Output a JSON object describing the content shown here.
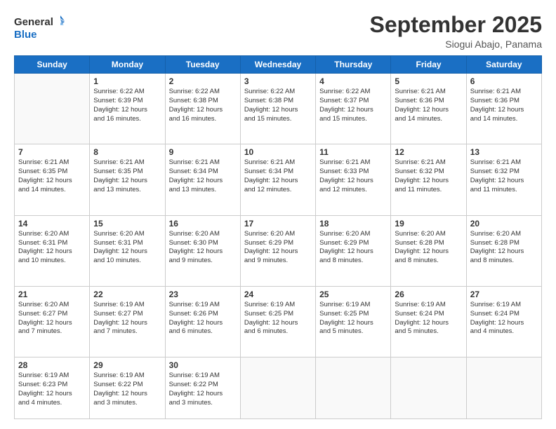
{
  "header": {
    "logo": {
      "line1": "General",
      "line2": "Blue"
    },
    "title": "September 2025",
    "subtitle": "Siogui Abajo, Panama"
  },
  "days_of_week": [
    "Sunday",
    "Monday",
    "Tuesday",
    "Wednesday",
    "Thursday",
    "Friday",
    "Saturday"
  ],
  "weeks": [
    [
      {
        "day": "",
        "info": ""
      },
      {
        "day": "1",
        "info": "Sunrise: 6:22 AM\nSunset: 6:39 PM\nDaylight: 12 hours\nand 16 minutes."
      },
      {
        "day": "2",
        "info": "Sunrise: 6:22 AM\nSunset: 6:38 PM\nDaylight: 12 hours\nand 16 minutes."
      },
      {
        "day": "3",
        "info": "Sunrise: 6:22 AM\nSunset: 6:38 PM\nDaylight: 12 hours\nand 15 minutes."
      },
      {
        "day": "4",
        "info": "Sunrise: 6:22 AM\nSunset: 6:37 PM\nDaylight: 12 hours\nand 15 minutes."
      },
      {
        "day": "5",
        "info": "Sunrise: 6:21 AM\nSunset: 6:36 PM\nDaylight: 12 hours\nand 14 minutes."
      },
      {
        "day": "6",
        "info": "Sunrise: 6:21 AM\nSunset: 6:36 PM\nDaylight: 12 hours\nand 14 minutes."
      }
    ],
    [
      {
        "day": "7",
        "info": "Sunrise: 6:21 AM\nSunset: 6:35 PM\nDaylight: 12 hours\nand 14 minutes."
      },
      {
        "day": "8",
        "info": "Sunrise: 6:21 AM\nSunset: 6:35 PM\nDaylight: 12 hours\nand 13 minutes."
      },
      {
        "day": "9",
        "info": "Sunrise: 6:21 AM\nSunset: 6:34 PM\nDaylight: 12 hours\nand 13 minutes."
      },
      {
        "day": "10",
        "info": "Sunrise: 6:21 AM\nSunset: 6:34 PM\nDaylight: 12 hours\nand 12 minutes."
      },
      {
        "day": "11",
        "info": "Sunrise: 6:21 AM\nSunset: 6:33 PM\nDaylight: 12 hours\nand 12 minutes."
      },
      {
        "day": "12",
        "info": "Sunrise: 6:21 AM\nSunset: 6:32 PM\nDaylight: 12 hours\nand 11 minutes."
      },
      {
        "day": "13",
        "info": "Sunrise: 6:21 AM\nSunset: 6:32 PM\nDaylight: 12 hours\nand 11 minutes."
      }
    ],
    [
      {
        "day": "14",
        "info": "Sunrise: 6:20 AM\nSunset: 6:31 PM\nDaylight: 12 hours\nand 10 minutes."
      },
      {
        "day": "15",
        "info": "Sunrise: 6:20 AM\nSunset: 6:31 PM\nDaylight: 12 hours\nand 10 minutes."
      },
      {
        "day": "16",
        "info": "Sunrise: 6:20 AM\nSunset: 6:30 PM\nDaylight: 12 hours\nand 9 minutes."
      },
      {
        "day": "17",
        "info": "Sunrise: 6:20 AM\nSunset: 6:29 PM\nDaylight: 12 hours\nand 9 minutes."
      },
      {
        "day": "18",
        "info": "Sunrise: 6:20 AM\nSunset: 6:29 PM\nDaylight: 12 hours\nand 8 minutes."
      },
      {
        "day": "19",
        "info": "Sunrise: 6:20 AM\nSunset: 6:28 PM\nDaylight: 12 hours\nand 8 minutes."
      },
      {
        "day": "20",
        "info": "Sunrise: 6:20 AM\nSunset: 6:28 PM\nDaylight: 12 hours\nand 8 minutes."
      }
    ],
    [
      {
        "day": "21",
        "info": "Sunrise: 6:20 AM\nSunset: 6:27 PM\nDaylight: 12 hours\nand 7 minutes."
      },
      {
        "day": "22",
        "info": "Sunrise: 6:19 AM\nSunset: 6:27 PM\nDaylight: 12 hours\nand 7 minutes."
      },
      {
        "day": "23",
        "info": "Sunrise: 6:19 AM\nSunset: 6:26 PM\nDaylight: 12 hours\nand 6 minutes."
      },
      {
        "day": "24",
        "info": "Sunrise: 6:19 AM\nSunset: 6:25 PM\nDaylight: 12 hours\nand 6 minutes."
      },
      {
        "day": "25",
        "info": "Sunrise: 6:19 AM\nSunset: 6:25 PM\nDaylight: 12 hours\nand 5 minutes."
      },
      {
        "day": "26",
        "info": "Sunrise: 6:19 AM\nSunset: 6:24 PM\nDaylight: 12 hours\nand 5 minutes."
      },
      {
        "day": "27",
        "info": "Sunrise: 6:19 AM\nSunset: 6:24 PM\nDaylight: 12 hours\nand 4 minutes."
      }
    ],
    [
      {
        "day": "28",
        "info": "Sunrise: 6:19 AM\nSunset: 6:23 PM\nDaylight: 12 hours\nand 4 minutes."
      },
      {
        "day": "29",
        "info": "Sunrise: 6:19 AM\nSunset: 6:22 PM\nDaylight: 12 hours\nand 3 minutes."
      },
      {
        "day": "30",
        "info": "Sunrise: 6:19 AM\nSunset: 6:22 PM\nDaylight: 12 hours\nand 3 minutes."
      },
      {
        "day": "",
        "info": ""
      },
      {
        "day": "",
        "info": ""
      },
      {
        "day": "",
        "info": ""
      },
      {
        "day": "",
        "info": ""
      }
    ]
  ]
}
